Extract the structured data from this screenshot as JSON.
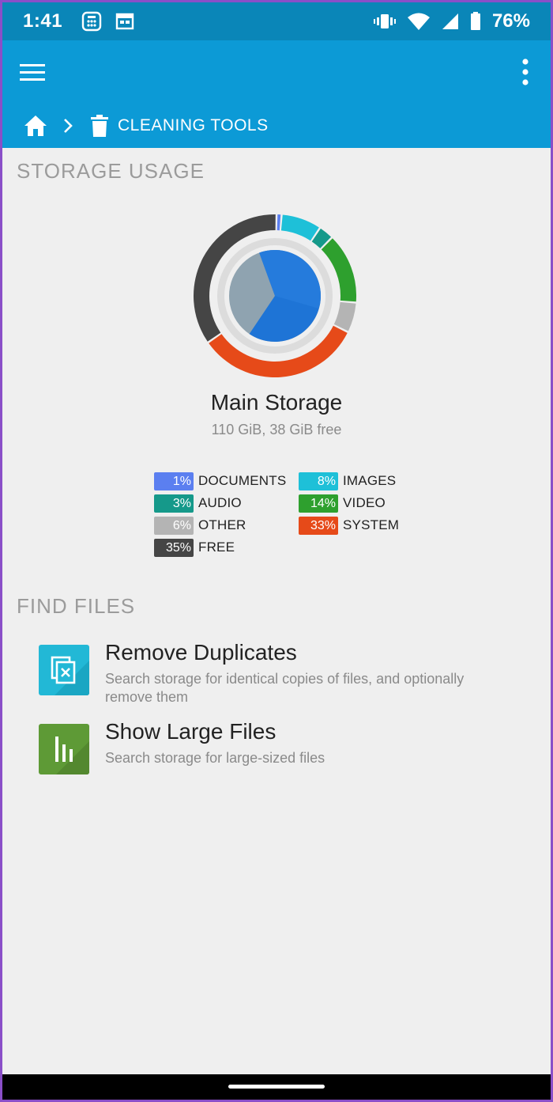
{
  "status_bar": {
    "time": "1:41",
    "battery": "76%",
    "icons": [
      "calculator-icon",
      "calendar-icon",
      "vibrate-icon",
      "wifi-icon",
      "signal-icon",
      "battery-icon"
    ]
  },
  "app_bar": {
    "breadcrumb": {
      "current_first": "C",
      "current_rest": "leaning ",
      "current_second": "T",
      "current_second_rest": "ools",
      "current": "Cleaning Tools"
    },
    "colors": {
      "status": "#0a86b8",
      "bar": "#0c9ad6"
    }
  },
  "storage": {
    "section_title": "Storage Usage",
    "name": "Main Storage",
    "summary": "110 GiB, 38 GiB free",
    "legend": [
      {
        "pct": "1%",
        "label": "DOCUMENTS",
        "color": "#5b7ff0"
      },
      {
        "pct": "8%",
        "label": "IMAGES",
        "color": "#1ec0d8"
      },
      {
        "pct": "3%",
        "label": "AUDIO",
        "color": "#15998a"
      },
      {
        "pct": "14%",
        "label": "VIDEO",
        "color": "#2ea02e"
      },
      {
        "pct": "6%",
        "label": "OTHER",
        "color": "#b4b4b4"
      },
      {
        "pct": "33%",
        "label": "SYSTEM",
        "color": "#e64a19"
      },
      {
        "pct": "35%",
        "label": "FREE",
        "color": "#454545"
      }
    ],
    "chart_data": {
      "type": "pie",
      "categories": [
        "DOCUMENTS",
        "IMAGES",
        "AUDIO",
        "VIDEO",
        "OTHER",
        "SYSTEM",
        "FREE"
      ],
      "values": [
        1,
        8,
        3,
        14,
        6,
        33,
        35
      ],
      "colors": [
        "#5b7ff0",
        "#1ec0d8",
        "#15998a",
        "#2ea02e",
        "#b4b4b4",
        "#e64a19",
        "#454545"
      ],
      "inner_used_fraction": 0.65
    }
  },
  "find_files": {
    "section_title": "Find Files",
    "items": [
      {
        "title": "Remove Duplicates",
        "desc": "Search storage for identical copies of files, and optionally remove them",
        "icon": "duplicate-files-icon",
        "color": "#22b8d6"
      },
      {
        "title": "Show Large Files",
        "desc": "Search storage for large-sized files",
        "icon": "bar-chart-icon",
        "color": "#5e9a36"
      }
    ]
  }
}
